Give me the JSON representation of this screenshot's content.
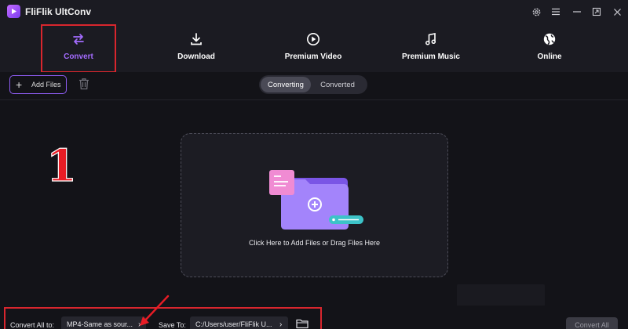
{
  "app": {
    "title": "FliFlik UltConv"
  },
  "window_controls": {
    "icons": [
      "gear-icon",
      "menu-icon",
      "minimize-icon",
      "restore-icon",
      "close-icon"
    ]
  },
  "nav": {
    "items": [
      {
        "label": "Convert",
        "icon": "swap-arrows-icon",
        "active": true
      },
      {
        "label": "Download",
        "icon": "download-icon",
        "active": false
      },
      {
        "label": "Premium Video",
        "icon": "play-circle-icon",
        "active": false
      },
      {
        "label": "Premium Music",
        "icon": "music-note-icon",
        "active": false
      },
      {
        "label": "Online",
        "icon": "globe-icon",
        "active": false
      }
    ]
  },
  "toolbar": {
    "add_files_label": "Add Files",
    "tabs": [
      {
        "label": "Converting",
        "active": true
      },
      {
        "label": "Converted",
        "active": false
      }
    ]
  },
  "main": {
    "step_number": "1",
    "dropzone_text": "Click Here to Add Files or Drag Files Here"
  },
  "bottom": {
    "convert_all_to_label": "Convert All to:",
    "format_value": "MP4-Same as sour...",
    "save_to_label": "Save To:",
    "path_value": "C:/Users/user/FliFlik U...",
    "convert_all_button": "Convert All"
  },
  "colors": {
    "accent": "#a46cff",
    "highlight": "#d9262e",
    "background": "#131318",
    "panel": "#1b1b22"
  }
}
